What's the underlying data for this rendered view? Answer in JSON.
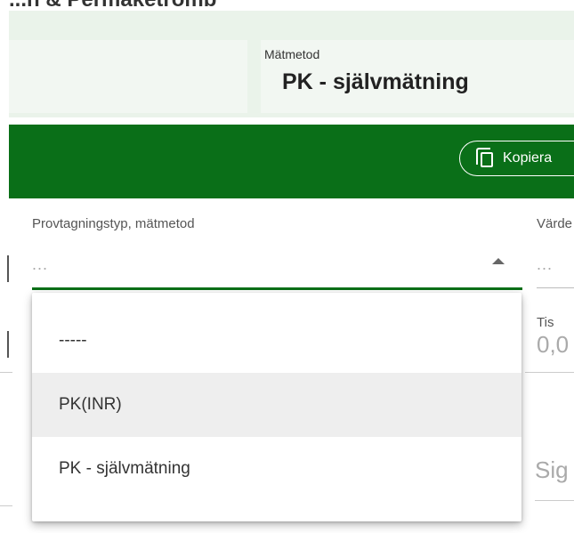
{
  "header": {
    "title": "...n & Permaketromb"
  },
  "info": {
    "matmetod_label": "Mätmetod",
    "matmetod_value": "PK - självmätning"
  },
  "toolbar": {
    "kopiera_label": "Kopiera"
  },
  "form": {
    "provtagning_label": "Provtagningstyp, mätmetod",
    "provtagning_value": "...",
    "right_label": "Värde",
    "right_value": "...",
    "tis_label": "Tis",
    "tis_value": "0,0",
    "sig_label": "Sig"
  },
  "dropdown": {
    "options": [
      "-----",
      "PK(INR)",
      "PK - självmätning"
    ],
    "highlighted_index": 1
  },
  "colors": {
    "accent_green": "#0a6f18",
    "panel_bg": "#eaf3ea"
  }
}
